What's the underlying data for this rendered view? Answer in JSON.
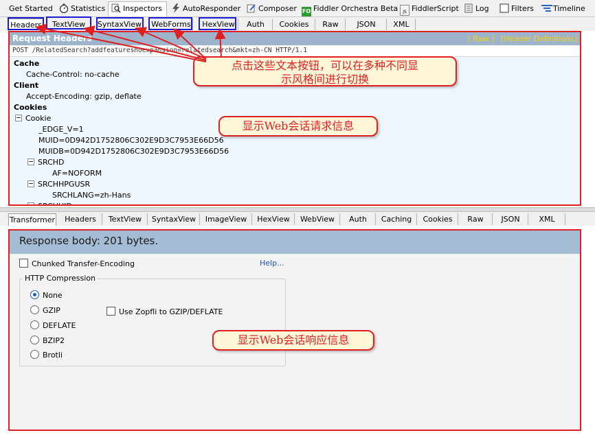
{
  "top_tabs": [
    {
      "label": "Get Started",
      "icon": "none"
    },
    {
      "label": "Statistics",
      "icon": "stopwatch-icon"
    },
    {
      "label": "Inspectors",
      "icon": "magnifier-icon",
      "active": true
    },
    {
      "label": "AutoResponder",
      "icon": "lightning-icon"
    },
    {
      "label": "Composer",
      "icon": "pencil-icon"
    },
    {
      "label": "Fiddler Orchestra Beta",
      "icon": "fo-icon",
      "icon_text": "FO"
    },
    {
      "label": "FiddlerScript",
      "icon": "script-icon",
      "icon_text": "JS"
    },
    {
      "label": "Log",
      "icon": "log-icon"
    },
    {
      "label": "Filters",
      "icon": "checkbox-icon"
    },
    {
      "label": "Timeline",
      "icon": "timeline-icon"
    }
  ],
  "request_tabs": [
    "Headers",
    "TextView",
    "SyntaxView",
    "WebForms",
    "HexView",
    "Auth",
    "Cookies",
    "Raw",
    "JSON",
    "XML"
  ],
  "request": {
    "title": "Request Headers",
    "link_raw": "[ Raw ]",
    "link_defs": "[Header Definitions]",
    "request_line": "POST /RelatedSearch?addfeaturesnoexpansion=relatedsearch&mkt=zh-CN HTTP/1.1",
    "tree": [
      {
        "text": "Cache",
        "level": 0,
        "bold": true
      },
      {
        "text": "Cache-Control: no-cache",
        "level": 1
      },
      {
        "text": "Client",
        "level": 0,
        "bold": true
      },
      {
        "text": "Accept-Encoding: gzip, deflate",
        "level": 1
      },
      {
        "text": "Cookies",
        "level": 0,
        "bold": true
      },
      {
        "text": "Cookie",
        "level": 1,
        "expander": true
      },
      {
        "text": "_EDGE_V=1",
        "level": 2
      },
      {
        "text": "MUID=0D942D1752806C302E9D3C7953E66D56",
        "level": 2
      },
      {
        "text": "MUIDB=0D942D1752806C302E9D3C7953E66D56",
        "level": 2
      },
      {
        "text": "SRCHD",
        "level": 2,
        "expander": true
      },
      {
        "text": "AF=NOFORM",
        "level": 3
      },
      {
        "text": "SRCHHPGUSR",
        "level": 2,
        "expander": true
      },
      {
        "text": "SRCHLANG=zh-Hans",
        "level": 3
      },
      {
        "text": "SRCHUID",
        "level": 2,
        "expander": true
      }
    ]
  },
  "response_tabs": [
    "Transformer",
    "Headers",
    "TextView",
    "SyntaxView",
    "ImageView",
    "HexView",
    "WebView",
    "Auth",
    "Caching",
    "Cookies",
    "Raw",
    "JSON",
    "XML"
  ],
  "response": {
    "header": "Response body: 201 bytes.",
    "chunked_label": "Chunked Transfer-Encoding",
    "help_link": "Help...",
    "compression_title": "HTTP Compression",
    "options": [
      "None",
      "GZIP",
      "DEFLATE",
      "BZIP2",
      "Brotli"
    ],
    "selected_option": "None",
    "zopfli_label": "Use Zopfli to GZIP/DEFLATE"
  },
  "annotations": {
    "buttons_note_line1": "点击这些文本按钮，可以在多种不同显",
    "buttons_note_line2": "示风格间进行切换",
    "request_note": "显示Web会话请求信息",
    "response_note": "显示Web会话响应信息"
  },
  "colors": {
    "annotation_red": "#e02020",
    "highlight_blue": "#1a1ad8",
    "link_yellow": "#f5d000",
    "header_blue": "#9db4cc"
  }
}
